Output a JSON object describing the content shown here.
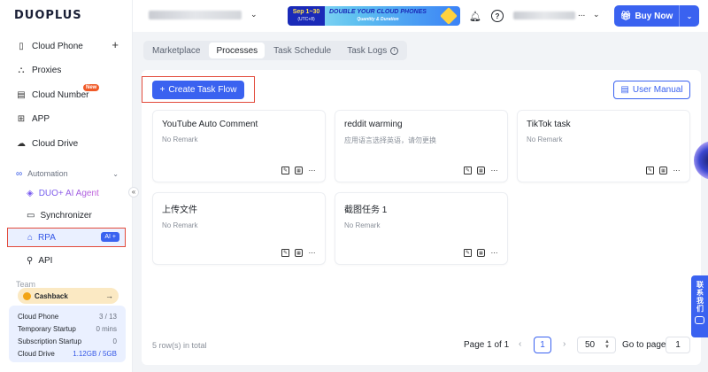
{
  "brand": {
    "logo_text": "DUOPLUS"
  },
  "sidebar": {
    "items": [
      {
        "label": "Cloud Phone",
        "icon": "phone-icon",
        "has_add": true
      },
      {
        "label": "Proxies",
        "icon": "proxies-icon"
      },
      {
        "label": "Cloud Number",
        "icon": "number-icon",
        "badge": "New"
      },
      {
        "label": "APP",
        "icon": "app-grid-icon"
      },
      {
        "label": "Cloud Drive",
        "icon": "cloud-icon"
      }
    ],
    "automation": {
      "title": "Automation",
      "items": [
        {
          "label": "DUO+ AI Agent",
          "icon": "ai-agent-icon"
        },
        {
          "label": "Synchronizer",
          "icon": "sync-icon"
        },
        {
          "label": "RPA",
          "icon": "rpa-icon",
          "pill": "AI +"
        },
        {
          "label": "API",
          "icon": "api-icon"
        }
      ]
    },
    "team_label": "Team",
    "cashback": {
      "label": "Cashback",
      "arrow": "→"
    },
    "usage": [
      {
        "label": "Cloud Phone",
        "value": "3 / 13"
      },
      {
        "label": "Temporary Startup",
        "value": "0 mins"
      },
      {
        "label": "Subscription Startup",
        "value": "0"
      },
      {
        "label": "Cloud Drive",
        "value": "1.12GB / 5GB"
      }
    ]
  },
  "header": {
    "promo": {
      "date": "Sep 1~30",
      "date_note": "(UTC+8)",
      "headline": "DOUBLE YOUR CLOUD PHONES",
      "subline": "Quantity & Duration"
    },
    "more": "...",
    "buy_label": "Buy Now"
  },
  "tabs": [
    {
      "label": "Marketplace",
      "active": false
    },
    {
      "label": "Processes",
      "active": true
    },
    {
      "label": "Task Schedule",
      "active": false
    },
    {
      "label": "Task Logs",
      "active": false,
      "info": "i"
    }
  ],
  "toolbar": {
    "create_label": "Create Task Flow",
    "manual_label": "User Manual"
  },
  "cards": [
    {
      "title": "YouTube Auto Comment",
      "subtitle": "No Remark"
    },
    {
      "title": "reddit warming",
      "subtitle": "应用语言选择英语，请勿更换"
    },
    {
      "title": "TikTok task",
      "subtitle": "No Remark"
    },
    {
      "title": "上传文件",
      "subtitle": "No Remark"
    },
    {
      "title": "截图任务 1",
      "subtitle": "No Remark"
    }
  ],
  "pagination": {
    "total_text": "5 row(s) in total",
    "page_text": "Page 1 of 1",
    "current": "1",
    "page_size": "50",
    "goto_label": "Go to page",
    "goto_value": "1"
  },
  "contact": {
    "label": "联系我们"
  },
  "colors": {
    "accent": "#3a62f0",
    "highlight": "#e24a3b",
    "promo_dark": "#1a2ab8"
  }
}
